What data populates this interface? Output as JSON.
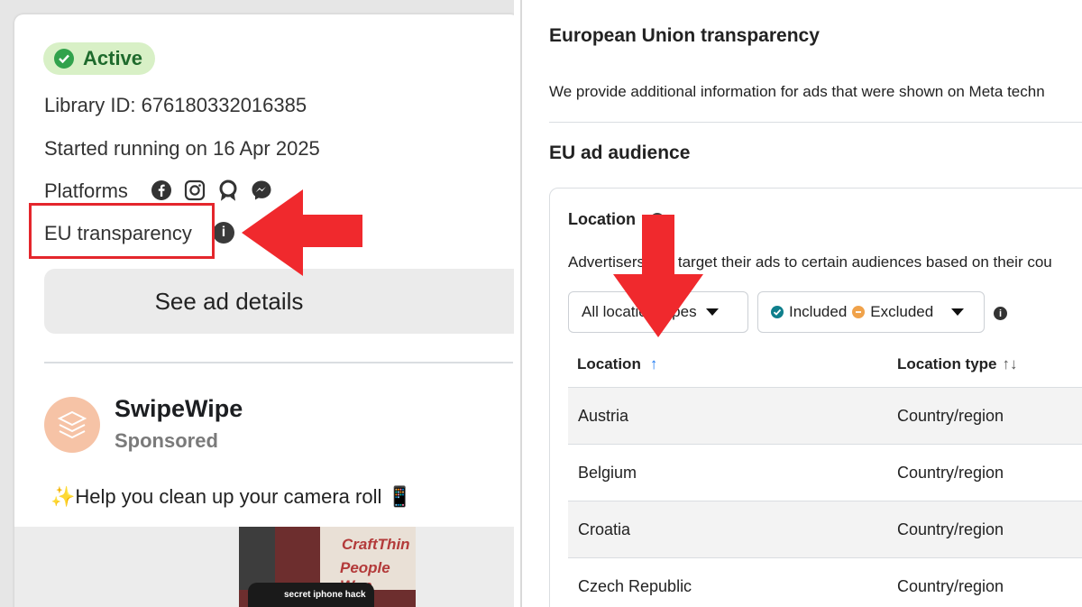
{
  "left_panel": {
    "status_badge": "Active",
    "library_id": "Library ID: 676180332016385",
    "started_running": "Started running on 16 Apr 2025",
    "platforms_label": "Platforms",
    "platform_icons": [
      "facebook-icon",
      "instagram-icon",
      "audience-network-icon",
      "messenger-icon"
    ],
    "eu_transparency_label": "EU transparency",
    "see_ad_details_button": "See ad details",
    "advertiser": {
      "name": "SwipeWipe",
      "sponsored": "Sponsored"
    },
    "ad_body": "✨Help you clean up your camera roll 📱",
    "media": {
      "overlay_text_1": "CraftThin",
      "overlay_text_2": "People Wan",
      "caption": "secret iphone hack"
    }
  },
  "right_panel": {
    "heading": "European Union transparency",
    "intro": "We provide additional information for ads that were shown on Meta techn",
    "audience_heading": "EU ad audience",
    "location_card": {
      "title": "Location",
      "description": "Advertisers can target their ads to certain audiences based on their cou",
      "filter_location_types": "All location types",
      "filter_included": "Included",
      "filter_excluded": "Excluded",
      "columns": [
        "Location",
        "Location type"
      ],
      "rows": [
        {
          "location": "Austria",
          "type": "Country/region"
        },
        {
          "location": "Belgium",
          "type": "Country/region"
        },
        {
          "location": "Croatia",
          "type": "Country/region"
        },
        {
          "location": "Czech Republic",
          "type": "Country/region"
        }
      ]
    }
  },
  "colors": {
    "annotation_red": "#e4262c",
    "active_green": "#31a24c",
    "included_teal": "#0f7f8c",
    "excluded_orange": "#f0a24a",
    "sort_blue": "#1877f2"
  }
}
